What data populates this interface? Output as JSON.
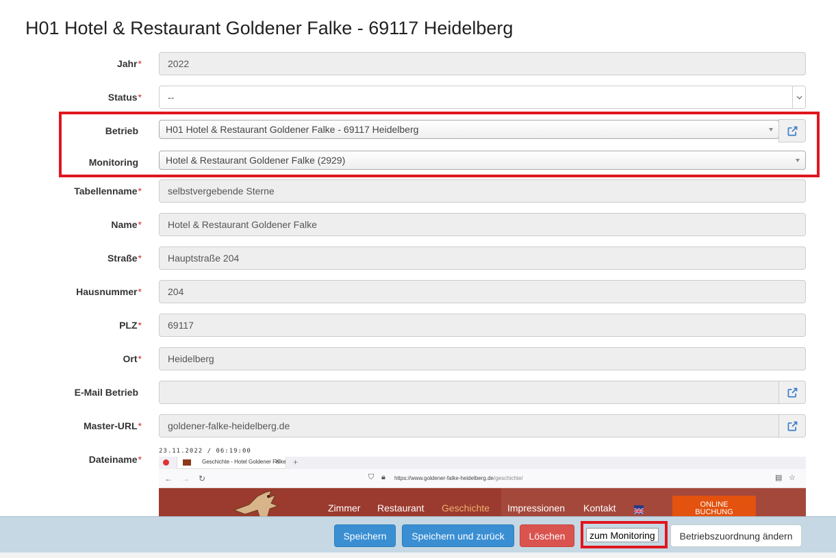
{
  "page": {
    "title": "H01 Hotel & Restaurant Goldener Falke - 69117 Heidelberg"
  },
  "required_marker": "*",
  "form": {
    "jahr": {
      "label": "Jahr",
      "value": "2022"
    },
    "status": {
      "label": "Status",
      "value": "--"
    },
    "betrieb": {
      "label": "Betrieb",
      "value": "H01 Hotel & Restaurant Goldener Falke - 69117 Heidelberg"
    },
    "monitoring": {
      "label": "Monitoring",
      "value": "Hotel & Restaurant Goldener Falke (2929)"
    },
    "tabellenname": {
      "label": "Tabellenname",
      "value": "selbstvergebende Sterne"
    },
    "name": {
      "label": "Name",
      "value": "Hotel & Restaurant Goldener Falke"
    },
    "strasse": {
      "label": "Straße",
      "value": "Hauptstraße 204"
    },
    "hausnummer": {
      "label": "Hausnummer",
      "value": "204"
    },
    "plz": {
      "label": "PLZ",
      "value": "69117"
    },
    "ort": {
      "label": "Ort",
      "value": "Heidelberg"
    },
    "email": {
      "label": "E-Mail Betrieb",
      "value": ""
    },
    "master_url": {
      "label": "Master-URL",
      "value": "goldener-falke-heidelberg.de"
    },
    "dateiname": {
      "label": "Dateiname"
    }
  },
  "screenshot": {
    "timestamp": "23.11.2022 / 06:19:00",
    "tab_title": "Geschichte - Hotel Goldener Falke",
    "url_host": "https://www.goldener-falke-heidelberg.de",
    "url_path": "/geschichte/",
    "nav": [
      "Zimmer",
      "Restaurant",
      "Geschichte",
      "Impressionen",
      "Kontakt"
    ],
    "active_nav": "Geschichte",
    "booking_line1": "ONLINE",
    "booking_line2": "BUCHUNG"
  },
  "footer": {
    "save": "Speichern",
    "save_back": "Speichern und zurück",
    "delete": "Löschen",
    "to_monitoring": "zum Monitoring",
    "change_assignment": "Betriebszuordnung ändern"
  },
  "colors": {
    "primary": "#3a8fd3",
    "danger": "#d9534f",
    "highlight": "#e0161e",
    "footer_bg": "#c5d8e3"
  },
  "icons": [
    "external-link-icon",
    "chevron-down-icon",
    "caret-down-icon"
  ]
}
